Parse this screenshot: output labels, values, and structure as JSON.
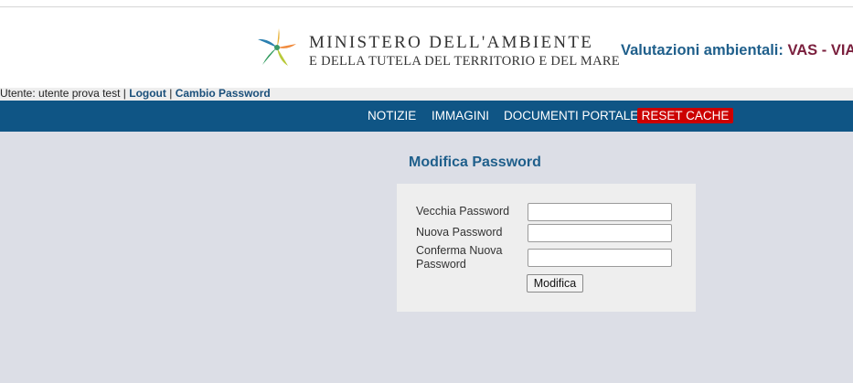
{
  "header": {
    "ministry_line1": "MINISTERO DELL'AMBIENTE",
    "ministry_line2": "E DELLA TUTELA DEL TERRITORIO E DEL MARE",
    "portal_title_part1": "Valutazioni ambientali: ",
    "portal_title_part2": "VAS - VIA",
    "logo_icon": "star-leaf-logo"
  },
  "userbar": {
    "user_text": "Utente: utente prova test",
    "separator": "|",
    "logout_label": "Logout",
    "change_password_label": "Cambio Password"
  },
  "nav": {
    "items": [
      "NOTIZIE",
      "IMMAGINI",
      "DOCUMENTI PORTALE"
    ],
    "reset_label": "RESET CACHE"
  },
  "form": {
    "title": "Modifica Password",
    "old_password_label": "Vecchia Password",
    "new_password_label": "Nuova Password",
    "confirm_password_label_line1": "Conferma Nuova",
    "confirm_password_label_line2": "Password",
    "old_password_value": "",
    "new_password_value": "",
    "confirm_password_value": "",
    "submit_label": "Modifica"
  },
  "colors": {
    "navbar": "#0f5585",
    "reset": "#cc0000",
    "title_blue": "#1f5f8b",
    "title_red": "#7a1f3d",
    "background": "#dcdee6",
    "panel": "#eeeeee"
  }
}
